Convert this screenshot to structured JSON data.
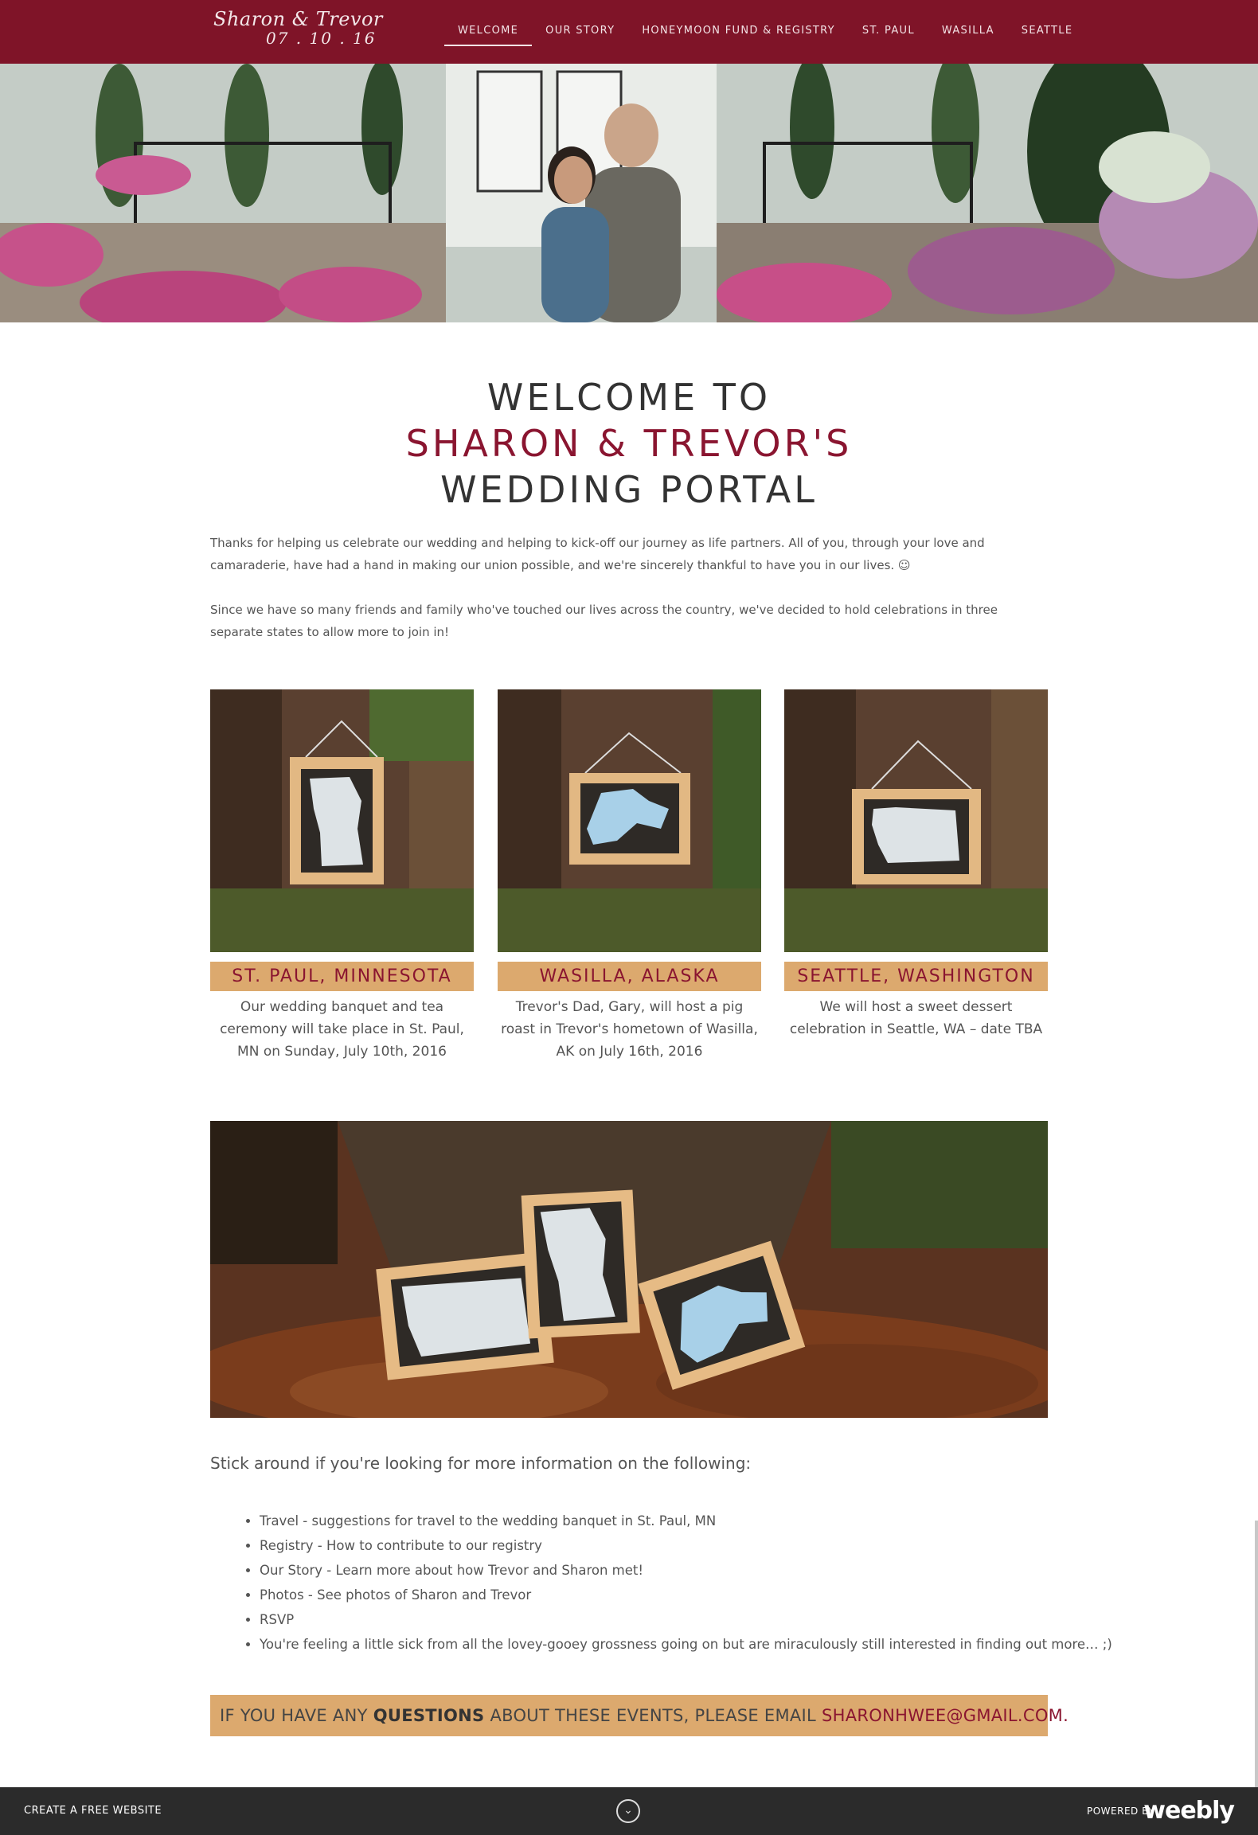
{
  "header": {
    "logo_line1": "Sharon & Trevor",
    "logo_line2": "07 . 10 . 16",
    "nav": [
      {
        "label": "WELCOME",
        "active": true
      },
      {
        "label": "OUR STORY"
      },
      {
        "label": "HONEYMOON FUND & REGISTRY"
      },
      {
        "label": "ST. PAUL"
      },
      {
        "label": "WASILLA"
      },
      {
        "label": "SEATTLE"
      }
    ]
  },
  "welcome": {
    "line1": "WELCOME TO",
    "line2": "SHARON & TREVOR'S",
    "line3": "WEDDING PORTAL"
  },
  "intro": {
    "p1": "Thanks for helping us celebrate our wedding and helping to kick-off our journey as life partners. All of you, through your love and camaraderie, have had a hand in making our union possible, and we're sincerely thankful to have you in our lives. ☺",
    "p2": "Since we have so many friends and family who've touched our lives across the country, we've decided to hold celebrations in three separate states to allow more to join in!"
  },
  "cards": [
    {
      "label": "ST. PAUL, MINNESOTA",
      "desc": "Our wedding banquet and tea ceremony will take place in St. Paul, MN on Sunday, July 10th, 2016"
    },
    {
      "label": "WASILLA, ALASKA",
      "desc": "Trevor's Dad, Gary, will host a pig roast in Trevor's hometown of Wasilla, AK on July 16th, 2016"
    },
    {
      "label": "SEATTLE, WASHINGTON",
      "desc": "We will host a sweet dessert celebration in Seattle, WA – date TBA"
    }
  ],
  "more": {
    "heading": "Stick around if you're looking for more information on the following:",
    "items": [
      "Travel - suggestions for travel to the wedding banquet in St. Paul, MN",
      "Registry - How to contribute to our registry",
      "Our Story - Learn more about how Trevor and Sharon met!",
      "Photos - See photos of Sharon and Trevor",
      "RSVP",
      "You're feeling a little sick from all the lovey-gooey grossness going on but are miraculously still interested in finding out more… ;)"
    ]
  },
  "callout": {
    "pre": "IF YOU HAVE ANY ",
    "bold": "QUESTIONS",
    "mid": " ABOUT THESE EVENTS, PLEASE EMAIL ",
    "email": "SHARONHWEE@GMAIL.COM."
  },
  "footer": {
    "create": "CREATE A FREE WEBSITE",
    "powered": "POWERED BY",
    "brand": "weebly"
  },
  "colors": {
    "brand": "#7f1428",
    "accent": "#8a1530",
    "label_bg": "#dca96e",
    "footer": "#2b2b2b"
  }
}
